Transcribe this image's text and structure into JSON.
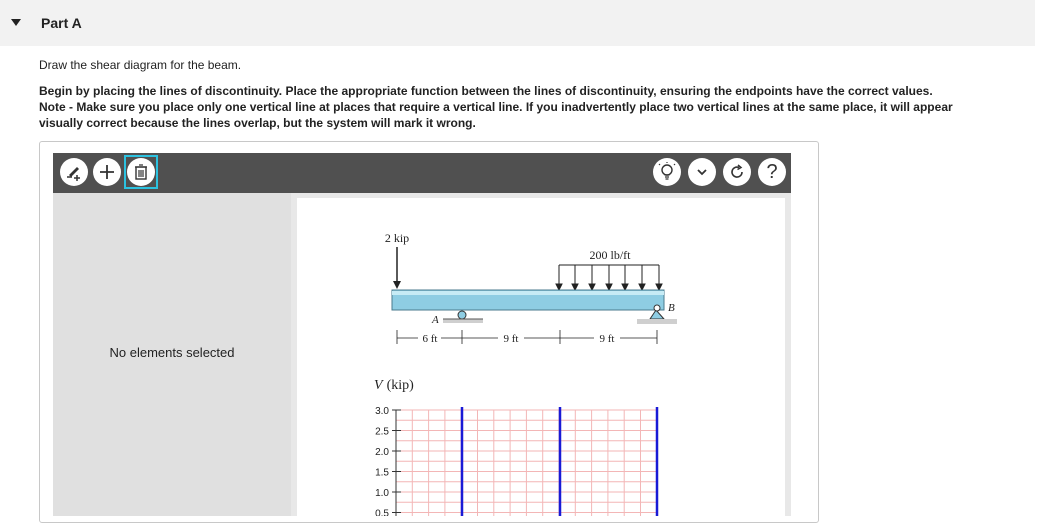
{
  "part": {
    "title": "Part A"
  },
  "intro": "Draw the shear diagram for the beam.",
  "instructions": [
    "Begin by placing the lines of discontinuity. Place the appropriate function between the lines of discontinuity, ensuring the endpoints have the correct values.",
    "Note - Make sure you place only one vertical line at places that require a vertical line. If you inadvertently place two vertical lines at the same place, it will appear",
    "visually correct because the lines overlap, but the system will mark it wrong."
  ],
  "toolbar": {
    "left_tools": [
      "pencil-tool",
      "add-tool",
      "trash-tool"
    ],
    "right_tools": [
      "hint-bulb",
      "dropdown",
      "reset",
      "help"
    ],
    "help_label": "?"
  },
  "side_panel": {
    "status": "No elements selected"
  },
  "beam": {
    "point_load": "2 kip",
    "dist_load": "200 lb/ft",
    "label_A": "A",
    "label_B": "B",
    "dim1": "6 ft",
    "dim2": "9 ft",
    "dim3": "9 ft"
  },
  "graph": {
    "ylabel_var": "V",
    "ylabel_unit": "(kip)",
    "yticks": [
      "3.0",
      "2.5",
      "2.0",
      "1.5",
      "1.0",
      "0.5"
    ]
  },
  "colors": {
    "beam": "#8ecde3",
    "discontinuity_line": "#1a1ad6",
    "grid": "#f3b6b6",
    "selection": "#2cc2e0"
  }
}
